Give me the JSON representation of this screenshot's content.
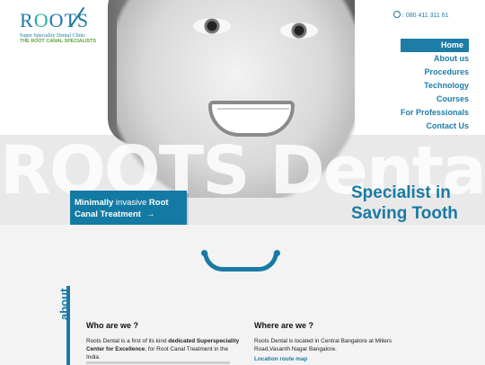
{
  "brand": {
    "name_part1": "R",
    "name_o": "O",
    "name_part2": "OTS",
    "subtitle": "Super Speciality Dental Clinic",
    "tagline": "THE ROOT CANAL SPECIALISTS",
    "color_primary": "#1a7aa5",
    "color_secondary": "#5aa632"
  },
  "header": {
    "phone_icon": "phone-icon",
    "phone": ": 080 411 311 61"
  },
  "nav": {
    "items": [
      {
        "label": "Home",
        "active": true
      },
      {
        "label": "About us"
      },
      {
        "label": "Procedures"
      },
      {
        "label": "Technology"
      },
      {
        "label": "Courses"
      },
      {
        "label": "For Professionals"
      },
      {
        "label": "Contact Us"
      }
    ]
  },
  "hero": {
    "watermark": "ROOTS Dental",
    "headline": "Specialist in Saving Tooth",
    "cta_bold1": "Minimally",
    "cta_light": " invasive ",
    "cta_bold2": "Root",
    "cta_line2": "Canal Treatment",
    "cta_arrow": "→"
  },
  "about": {
    "side_label": "about",
    "who_title": "Who are we ?",
    "who_text_1": "Roots Dental is a first of its kind ",
    "who_text_bold": "dedicated Superspeciality Center for Excellence",
    "who_text_2": ", for Root Canal Treatment in the India.",
    "where_title": "Where are we ?",
    "where_text": "Roots Dental is located in Central Bangalore at Millers Road,Vasanth Nagar Bangalore.",
    "where_link": "Location route map"
  }
}
